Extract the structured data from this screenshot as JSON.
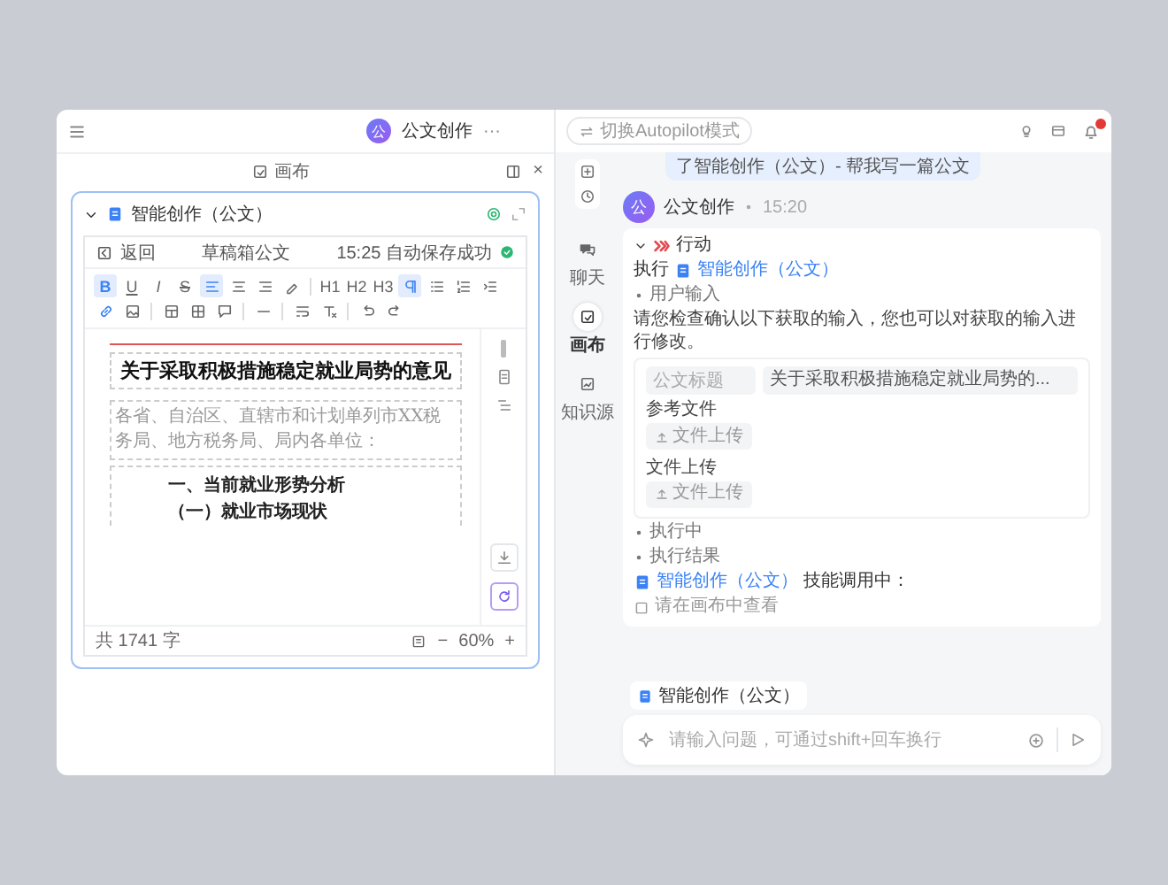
{
  "top_bar": {
    "avatar": "公",
    "title": "公文创作",
    "more": "···"
  },
  "canvas": {
    "title": "画布",
    "close": "×",
    "card": {
      "title": "智能创作（公文）",
      "expanded": true,
      "editor": {
        "back": "返回",
        "doc_name": "草稿箱公文",
        "save_status": "15:25 自动保存成功",
        "toolbar": [
          {
            "kind": "bold",
            "label": "B",
            "selected": true
          },
          {
            "kind": "underline",
            "label": "U",
            "selected": false
          },
          {
            "kind": "italic",
            "label": "I",
            "selected": false
          },
          {
            "kind": "strike",
            "label": "S",
            "selected": false
          },
          {
            "kind": "align-left",
            "selected": true
          },
          {
            "kind": "align-center",
            "selected": false
          },
          {
            "kind": "align-right",
            "selected": false
          },
          {
            "kind": "brush",
            "selected": false
          },
          {
            "kind": "separator"
          },
          {
            "kind": "heading",
            "label": "H1",
            "selected": false
          },
          {
            "kind": "heading",
            "label": "H2",
            "selected": false
          },
          {
            "kind": "heading",
            "label": "H3",
            "selected": false
          },
          {
            "kind": "paragraph",
            "selected": true
          },
          {
            "kind": "bullet-list",
            "selected": false
          },
          {
            "kind": "number-list",
            "selected": false
          },
          {
            "kind": "indent",
            "selected": false
          },
          {
            "kind": "link",
            "selected": false
          },
          {
            "kind": "image",
            "selected": false
          },
          {
            "kind": "separator"
          },
          {
            "kind": "table",
            "selected": false
          },
          {
            "kind": "grid",
            "selected": false
          },
          {
            "kind": "comment",
            "selected": false
          },
          {
            "kind": "separator"
          },
          {
            "kind": "rule",
            "selected": false
          },
          {
            "kind": "separator"
          },
          {
            "kind": "wrap",
            "selected": false
          },
          {
            "kind": "clear-format",
            "selected": false
          },
          {
            "kind": "separator"
          },
          {
            "kind": "undo",
            "selected": false
          },
          {
            "kind": "redo",
            "selected": false
          }
        ],
        "document": {
          "title": "关于采取积极措施稳定就业局势的意见",
          "recipients": "各省、自治区、直辖市和计划单列市XX税务局、地方税务局、局内各单位：",
          "heading": "一、当前就业形势分析",
          "subheading": "（一）就业市场现状"
        },
        "word_count": "共 1741 字",
        "zoom_out": "−",
        "zoom": "60%",
        "zoom_in": "+"
      }
    }
  },
  "chat": {
    "mode_button": "切换Autopilot模式",
    "unread": true,
    "rail": [
      {
        "kind": "chat",
        "label": "聊天",
        "selected": false
      },
      {
        "kind": "canvas",
        "label": "画布",
        "selected": true
      },
      {
        "kind": "knowledge",
        "label": "知识源",
        "selected": false
      }
    ],
    "previous_bubble": "了智能创作（公文）- 帮我写一篇公文",
    "message": {
      "avatar": "公",
      "sender": "公文创作",
      "time": "15:20",
      "action": {
        "title": "行动",
        "expanded": true,
        "execute_label": "执行",
        "skill": "智能创作（公文）",
        "steps": [
          {
            "kind": "input",
            "label": "用户输入",
            "description": "请您检查确认以下获取的输入，您也可以对获取的输入进行修改。",
            "fields": [
              {
                "placeholder": "公文标题"
              },
              {
                "value": "关于采取积极措施稳定就业局势的..."
              }
            ],
            "uploads": [
              {
                "label": "参考文件",
                "button": "文件上传"
              },
              {
                "label": "文件上传",
                "button": "文件上传"
              }
            ]
          },
          {
            "kind": "plain",
            "label": "执行中"
          },
          {
            "kind": "result",
            "label": "执行结果",
            "skill": "智能创作（公文）",
            "status": "技能调用中：",
            "hint": "请在画布中查看"
          }
        ]
      }
    },
    "selected_skill": "智能创作（公文）",
    "input": {
      "placeholder": "请输入问题，可通过shift+回车换行"
    }
  }
}
